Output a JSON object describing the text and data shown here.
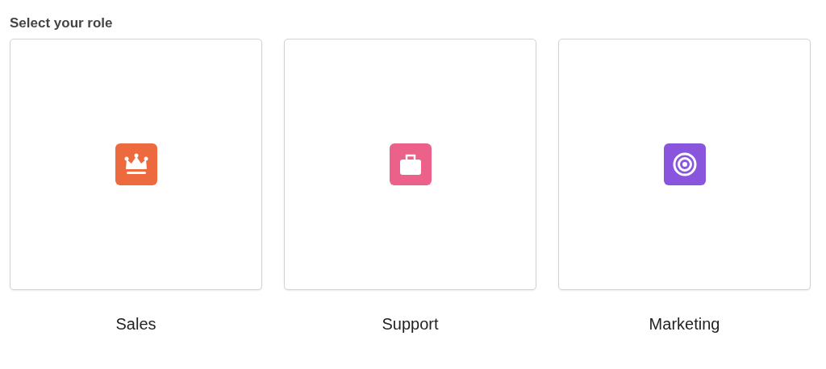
{
  "title": "Select your role",
  "roles": [
    {
      "label": "Sales",
      "kind": "crown",
      "color": "#ed6a3f",
      "selected": false
    },
    {
      "label": "Support",
      "kind": "briefcase",
      "color": "#ec6189",
      "selected": false
    },
    {
      "label": "Marketing",
      "kind": "target",
      "color": "#8a55dd",
      "selected": false
    }
  ]
}
